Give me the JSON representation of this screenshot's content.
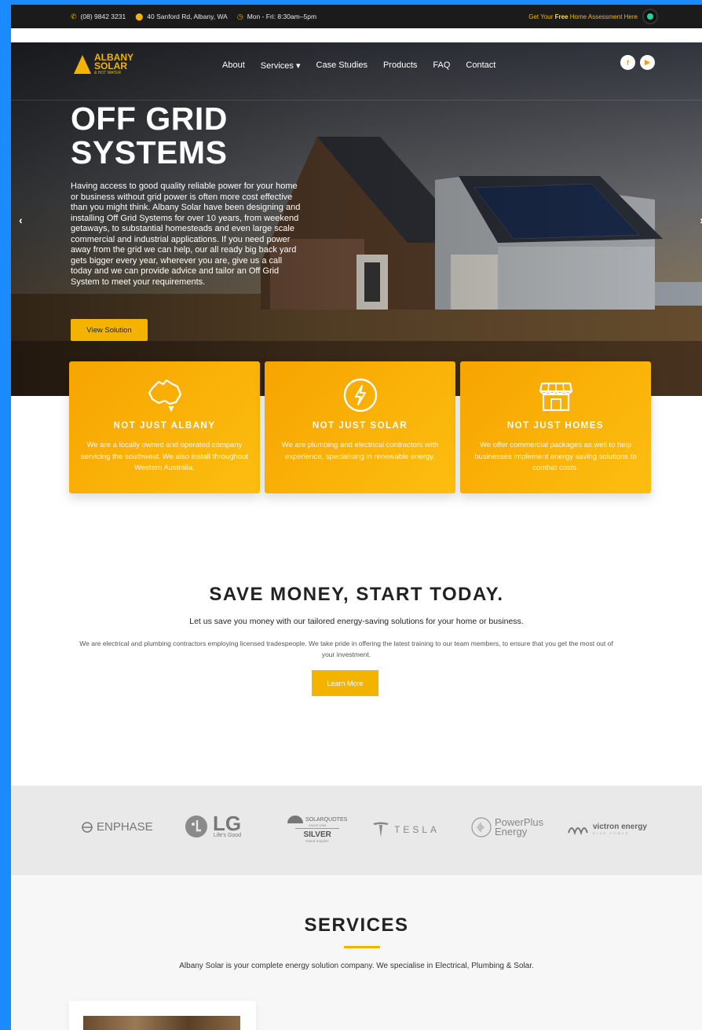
{
  "topbar": {
    "phone": "(08) 9842 3231",
    "address": "40 Sanford Rd, Albany, WA",
    "hours": "Mon - Fri: 8:30am–5pm",
    "cta_prefix": "Get Your ",
    "cta_bold": "Free",
    "cta_suffix": " Home Assessment Here"
  },
  "logo": {
    "line1": "ALBANY",
    "line2": "SOLAR",
    "line3": "& HOT WATER"
  },
  "nav": {
    "items": [
      "About",
      "Services",
      "Case Studies",
      "Products",
      "FAQ",
      "Contact"
    ],
    "services_caret": "▾"
  },
  "social": {
    "facebook": "f",
    "youtube": "▶"
  },
  "hero": {
    "title": "OFF GRID\nSYSTEMS",
    "text": "Having access to good quality reliable power for your home or business without grid power is often more cost effective than you might think. Albany Solar have been designing and installing Off Grid Systems for over 10 years, from weekend getaways, to substantial homesteads and even large scale commercial and industrial applications. If you need power away from the grid we can help, our all ready big back yard gets bigger every year, wherever you are, give us a call today and we can provide advice and tailor an Off Grid System to meet your requirements.",
    "button": "View Solution",
    "prev": "‹",
    "next": "›"
  },
  "cards": [
    {
      "icon": "australia-map-icon",
      "title": "NOT JUST ALBANY",
      "text": "We are a locally owned and operated company servicing the southwest. We also install throughout Western Australia."
    },
    {
      "icon": "energy-bolt-icon",
      "title": "NOT JUST SOLAR",
      "text": "We are plumbing and electrical contractors with experience, specialising in renewable energy."
    },
    {
      "icon": "storefront-icon",
      "title": "NOT JUST HOMES",
      "text": "We offer commercial packages as well to help businesses implement energy saving solutions to combat costs."
    }
  ],
  "save": {
    "title": "SAVE MONEY, START TODAY.",
    "subtitle": "Let us save you money with our tailored energy-saving solutions for your home or business.",
    "body": "We are electrical and plumbing contractors employing licensed tradespeople. We take pride in offering the latest training to our team members, to ensure that you get the most out of your investment.",
    "button": "Learn More"
  },
  "partners": {
    "enphase": "ENPHASE",
    "lg": "LG",
    "lg_tag": "Life's Good",
    "solarquotes": "SOLARQUOTES",
    "solarquotes_since": "SINCE 2009",
    "solarquotes_tier": "SILVER",
    "solarquotes_note": "Rated Supplier",
    "tesla": "TESLA",
    "powerplus_1": "PowerPlus",
    "powerplus_2": "Energy",
    "victron": "victron energy",
    "victron_tag": "BLUE POWER"
  },
  "services": {
    "title": "SERVICES",
    "subtitle": "Albany Solar is your complete energy solution company. We specialise in Electrical, Plumbing & Solar."
  },
  "colors": {
    "accent": "#f5b301",
    "topbar": "#1b1b1b",
    "frame": "#1a8cff"
  }
}
